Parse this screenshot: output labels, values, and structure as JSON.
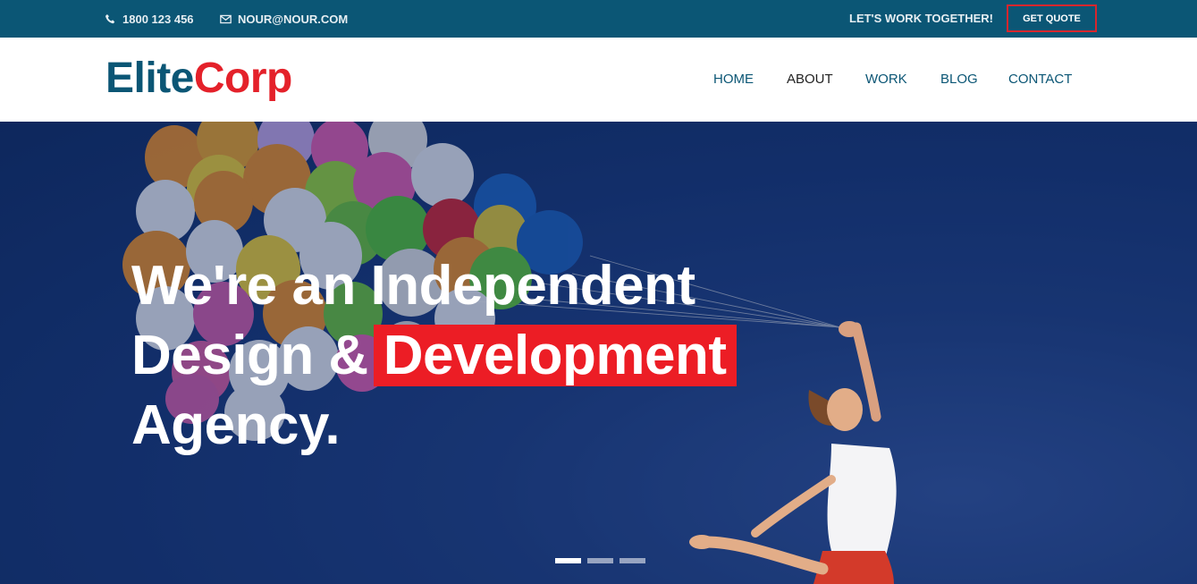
{
  "topbar": {
    "phone": "1800 123 456",
    "email": "NOUR@NOUR.COM",
    "tagline": "LET'S WORK TOGETHER!",
    "quote_button": "GET QUOTE"
  },
  "logo": {
    "part1": "Elite",
    "part2": "Corp"
  },
  "nav": {
    "items": [
      {
        "label": "HOME",
        "active": false
      },
      {
        "label": "ABOUT",
        "active": true
      },
      {
        "label": "WORK",
        "active": false
      },
      {
        "label": "BLOG",
        "active": false
      },
      {
        "label": "CONTACT",
        "active": false
      }
    ]
  },
  "hero": {
    "line1": "We're an Independent",
    "line2_prefix": "Design &",
    "line2_highlight": "Development",
    "line3": "Agency.",
    "slides": 3,
    "active_slide": 1
  },
  "colors": {
    "topbar_bg": "#0b5675",
    "brand_blue": "#0b5675",
    "brand_red": "#e4212a",
    "highlight_red": "#ec1d25",
    "hero_bg": "#14306a"
  },
  "icons": {
    "phone": "phone-icon",
    "email": "envelope-icon"
  }
}
